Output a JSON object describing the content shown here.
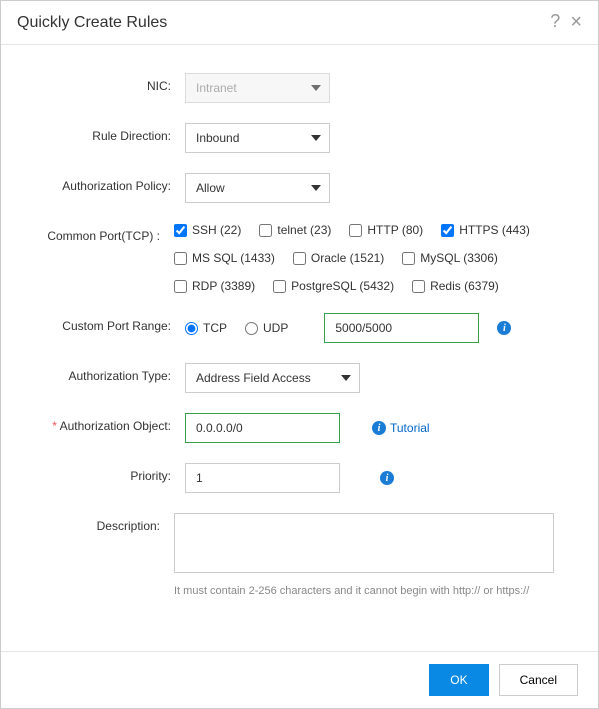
{
  "header": {
    "title": "Quickly Create Rules"
  },
  "labels": {
    "nic": "NIC:",
    "rule_direction": "Rule Direction:",
    "auth_policy": "Authorization Policy:",
    "common_port": "Common Port(TCP) :",
    "custom_port": "Custom Port Range:",
    "auth_type": "Authorization Type:",
    "auth_object": "Authorization Object:",
    "priority": "Priority:",
    "description": "Description:"
  },
  "nic": {
    "value": "Intranet"
  },
  "rule_direction": {
    "value": "Inbound"
  },
  "auth_policy": {
    "value": "Allow"
  },
  "ports": [
    {
      "label": "SSH (22)",
      "checked": true
    },
    {
      "label": "telnet (23)",
      "checked": false
    },
    {
      "label": "HTTP (80)",
      "checked": false
    },
    {
      "label": "HTTPS (443)",
      "checked": true
    },
    {
      "label": "MS SQL (1433)",
      "checked": false
    },
    {
      "label": "Oracle (1521)",
      "checked": false
    },
    {
      "label": "MySQL (3306)",
      "checked": false
    },
    {
      "label": "RDP (3389)",
      "checked": false
    },
    {
      "label": "PostgreSQL (5432)",
      "checked": false
    },
    {
      "label": "Redis (6379)",
      "checked": false
    }
  ],
  "custom_port": {
    "proto_tcp": "TCP",
    "proto_udp": "UDP",
    "selected": "tcp",
    "value": "5000/5000"
  },
  "auth_type": {
    "value": "Address Field Access"
  },
  "auth_object": {
    "value": "0.0.0.0/0"
  },
  "tutorial": "Tutorial",
  "priority": {
    "value": "1"
  },
  "description": {
    "value": "",
    "hint": "It must contain 2-256 characters and it cannot begin with http:// or https://"
  },
  "buttons": {
    "ok": "OK",
    "cancel": "Cancel"
  },
  "required_mark": "*"
}
